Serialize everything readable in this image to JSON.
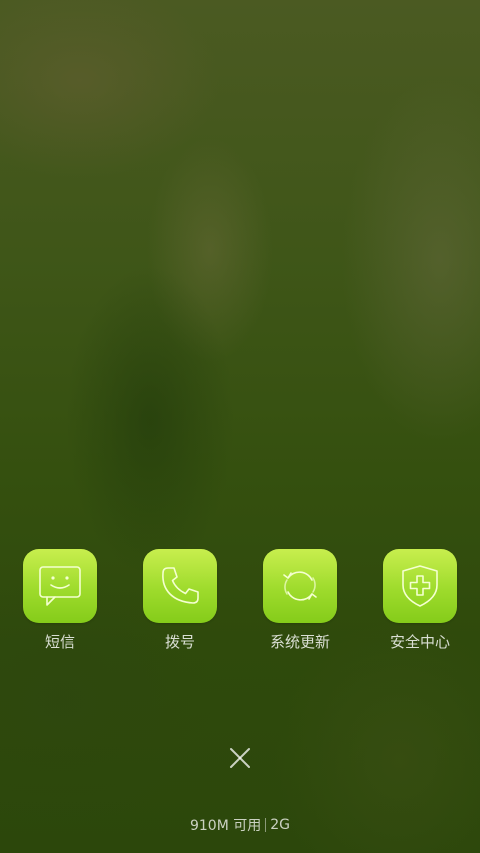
{
  "apps": [
    {
      "label": "短信",
      "icon": "message-icon"
    },
    {
      "label": "拨号",
      "icon": "phone-icon"
    },
    {
      "label": "系统更新",
      "icon": "refresh-icon"
    },
    {
      "label": "安全中心",
      "icon": "shield-icon"
    }
  ],
  "close": {
    "icon": "close-icon"
  },
  "status": {
    "memory": "910M 可用",
    "network": "2G"
  },
  "colors": {
    "icon_top": "#c8ee4e",
    "icon_bottom": "#85cc1a",
    "glyph": "#f4ffd0"
  }
}
